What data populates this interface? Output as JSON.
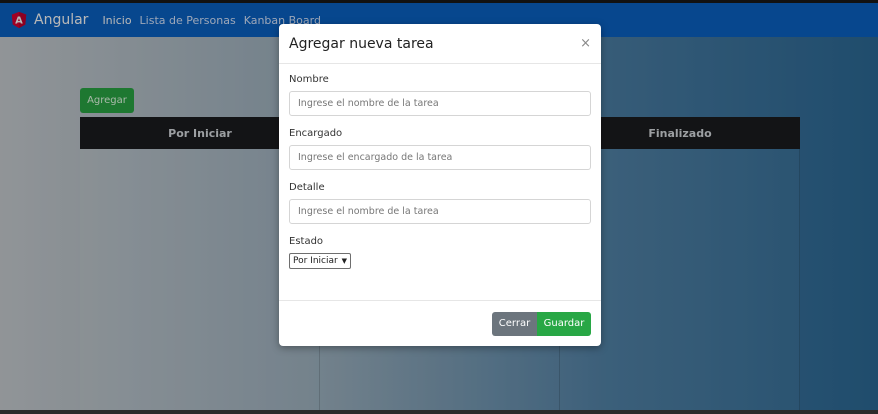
{
  "navbar": {
    "brand": "Angular",
    "links": [
      "Inicio",
      "Lista de Personas",
      "Kanban Board"
    ]
  },
  "page": {
    "add_button": "Agregar",
    "kanban_columns": [
      "Por Iniciar",
      "",
      "Finalizado"
    ]
  },
  "modal": {
    "title": "Agregar nueva tarea",
    "close": "×",
    "fields": {
      "nombre": {
        "label": "Nombre",
        "placeholder": "Ingrese el nombre de la tarea"
      },
      "encargado": {
        "label": "Encargado",
        "placeholder": "Ingrese el encargado de la tarea"
      },
      "detalle": {
        "label": "Detalle",
        "placeholder": "Ingrese el nombre de la tarea"
      },
      "estado": {
        "label": "Estado",
        "selected": "Por Iniciar"
      }
    },
    "buttons": {
      "cerrar": "Cerrar",
      "guardar": "Guardar"
    }
  },
  "colors": {
    "navbar": "#0b63c5",
    "success": "#28a745",
    "secondary": "#6c757d",
    "angular_red": "#dd0031"
  },
  "icons": {
    "brand_logo": "angular-logo-icon",
    "close": "close-icon",
    "select_arrow": "chevron-down-icon"
  }
}
